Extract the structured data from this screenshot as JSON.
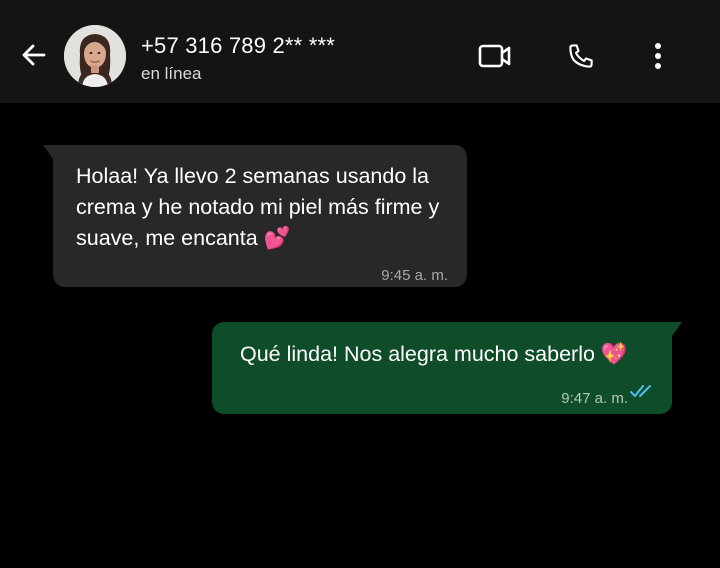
{
  "header": {
    "contact_name": "+57 316 789 2** ***",
    "status": "en línea",
    "icons": [
      "back-arrow-icon",
      "video-call-icon",
      "phone-call-icon",
      "more-options-icon"
    ]
  },
  "messages": [
    {
      "direction": "incoming",
      "text": "Holaa! Ya llevo 2 semanas usando la crema y he notado mi piel más firme y suave, me encanta 💕",
      "time": "9:45 a. m."
    },
    {
      "direction": "outgoing",
      "text": "Qué linda! Nos alegra mucho saberlo 💖",
      "time": "9:47 a. m.",
      "status_icon": "double-check-read-icon"
    }
  ],
  "colors": {
    "background": "#000000",
    "header": "#141414",
    "incoming_bubble": "#282828",
    "outgoing_bubble": "#0f4d2a",
    "read_ticks": "#53bdeb"
  }
}
